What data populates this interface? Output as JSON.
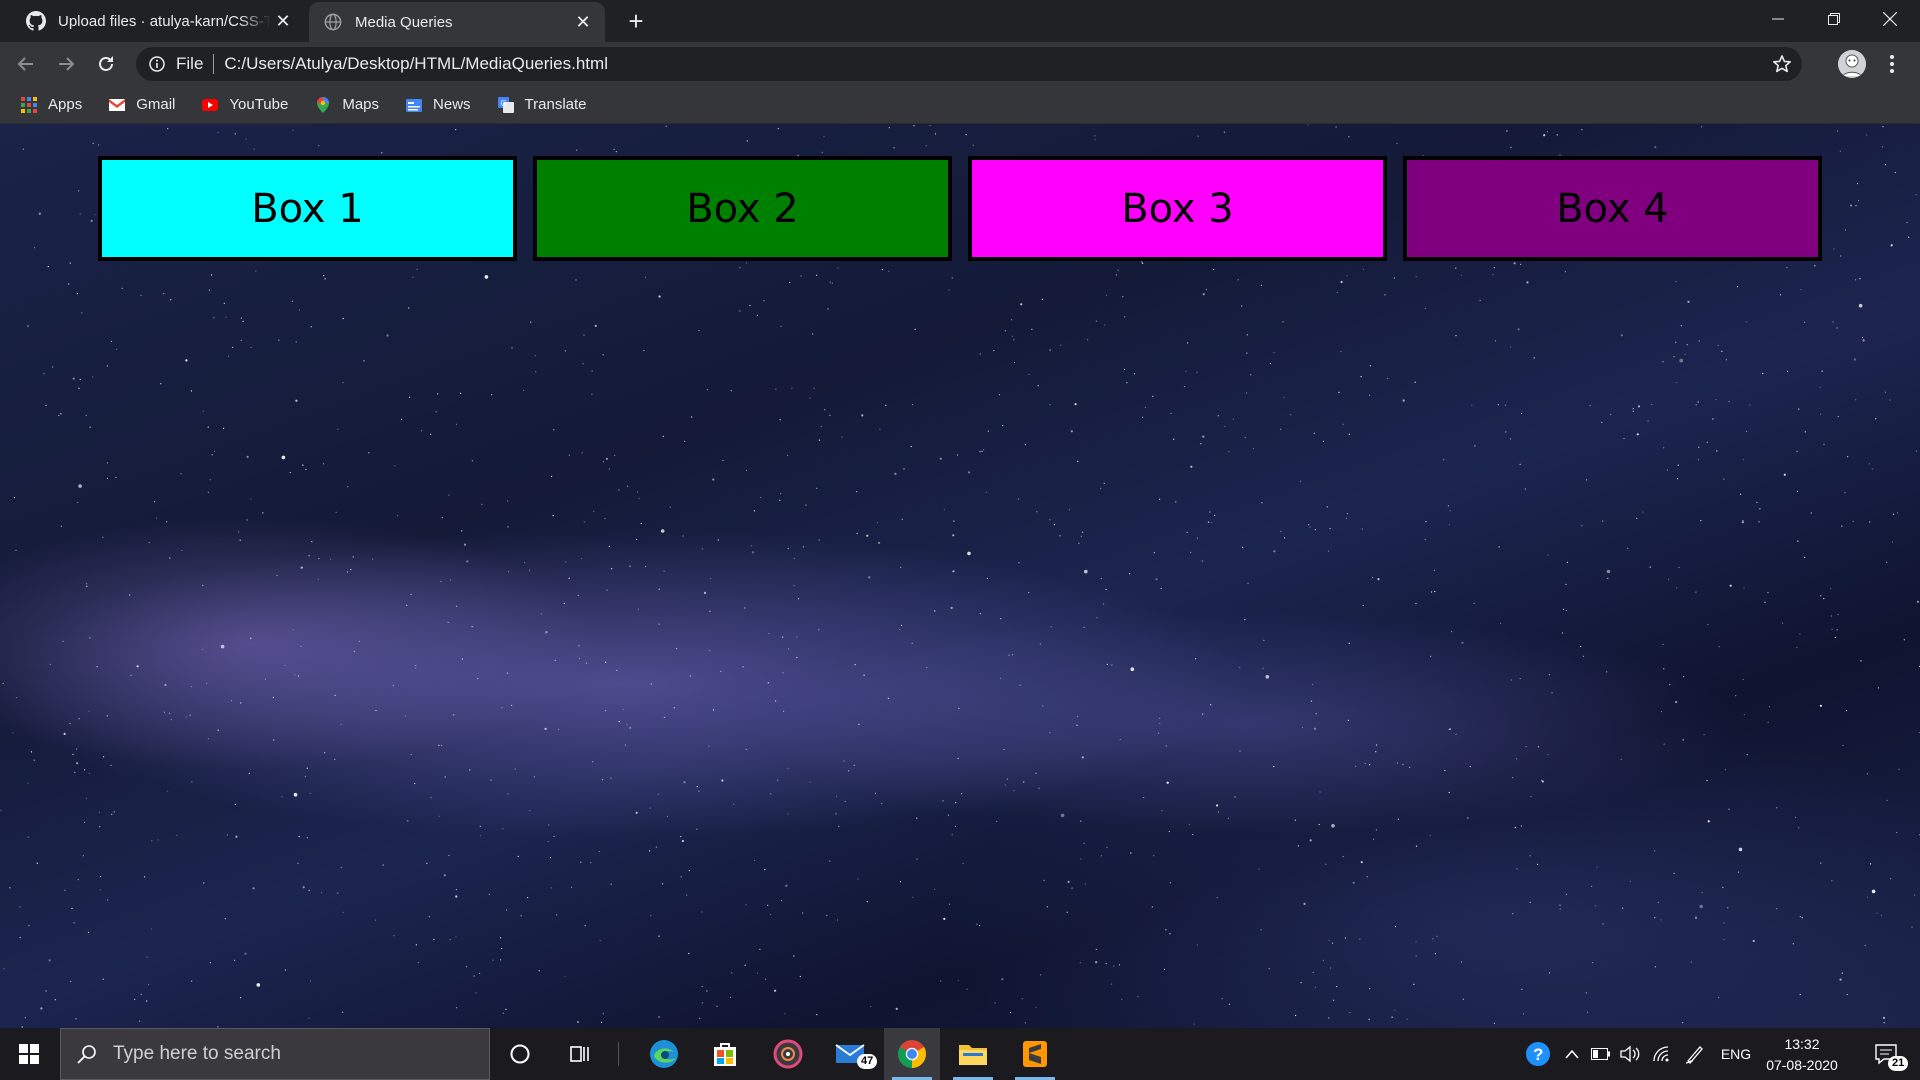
{
  "browser": {
    "tabs": [
      {
        "title": "Upload files · atulya-karn/CSS-Ta",
        "favicon": "github-icon",
        "active": false
      },
      {
        "title": "Media Queries",
        "favicon": "globe-icon",
        "active": true
      }
    ],
    "address_bar": {
      "scheme": "File",
      "url": "C:/Users/Atulya/Desktop/HTML/MediaQueries.html"
    },
    "bookmarks": [
      {
        "label": "Apps",
        "icon": "apps-grid-icon"
      },
      {
        "label": "Gmail",
        "icon": "gmail-icon"
      },
      {
        "label": "YouTube",
        "icon": "youtube-icon"
      },
      {
        "label": "Maps",
        "icon": "maps-pin-icon"
      },
      {
        "label": "News",
        "icon": "news-icon"
      },
      {
        "label": "Translate",
        "icon": "translate-icon"
      }
    ]
  },
  "page": {
    "boxes": [
      {
        "label": "Box 1",
        "color": "#00ffff"
      },
      {
        "label": "Box 2",
        "color": "#008000"
      },
      {
        "label": "Box 3",
        "color": "#ff00ff"
      },
      {
        "label": "Box 4",
        "color": "#800080"
      }
    ]
  },
  "taskbar": {
    "search_placeholder": "Type here to search",
    "mail_badge": "47",
    "notification_badge": "21",
    "language": "ENG",
    "time": "13:32",
    "date": "07-08-2020"
  }
}
